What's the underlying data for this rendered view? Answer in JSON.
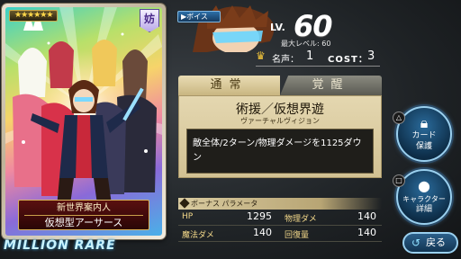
{
  "card": {
    "rarity_stars": "★★★★★★",
    "attribute_badge": "妨",
    "caption_sub": "新世界案内人",
    "caption_main": "仮想型アーサース",
    "rarity_text": "MILLION RARE"
  },
  "status": {
    "voice_label": "▶ボイス",
    "lv_label": "LV.",
    "lv_value": "60",
    "max_level_text": "最大レベル: 60",
    "meisei_label": "名声：",
    "meisei_value": "1",
    "cost_label": "COST：",
    "cost_value": "3"
  },
  "skill": {
    "tab_normal": "通常",
    "tab_awaken": "覚醒",
    "name": "術援／仮想界遊",
    "reading": "ヴァーチャルヴィジョン",
    "description": "敵全体/2ターン/物理ダメージを1125ダウン"
  },
  "bonus": {
    "header": "ボーナス パラメータ",
    "rows": [
      [
        {
          "label": "HP",
          "value": "1295"
        },
        {
          "label": "物理ダメ",
          "value": "140"
        }
      ],
      [
        {
          "label": "魔法ダメ",
          "value": "140"
        },
        {
          "label": "回復量",
          "value": "140"
        }
      ]
    ]
  },
  "buttons": {
    "lock_line1": "カード",
    "lock_line2": "保護",
    "detail_line1": "キャラクター",
    "detail_line2": "詳細",
    "back_label": "戻る",
    "lock_symbol": "△",
    "detail_symbol": "□"
  },
  "icons": {
    "lock": "lock-icon",
    "character": "person-icon",
    "back": "back-arrow-icon",
    "crown": "crown-icon"
  }
}
